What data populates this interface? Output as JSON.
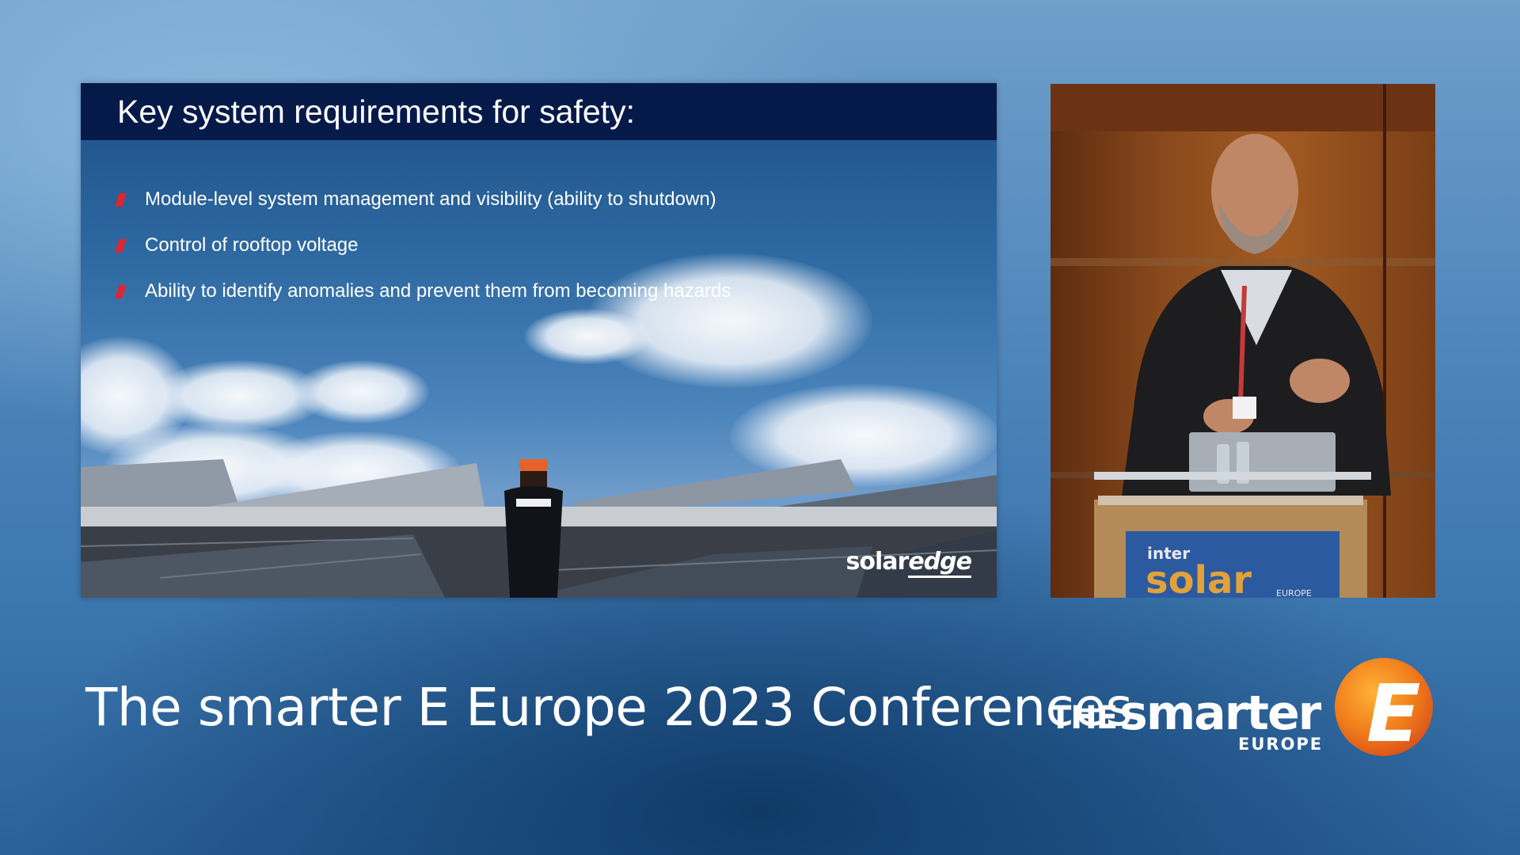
{
  "slide": {
    "title": "Key system requirements for safety:",
    "bullets": [
      "Module-level system management and visibility (ability to shutdown)",
      "Control of rooftop voltage",
      "Ability to identify anomalies and prevent them from becoming hazards"
    ],
    "logo_word1": "solar",
    "logo_word2": "edge",
    "shirt_text": "solaredge"
  },
  "speaker": {
    "podium_small": "inter",
    "podium_big": "solar",
    "podium_sub": "EUROPE"
  },
  "footer": {
    "title": "The smarter E Europe 2023 Conferences"
  },
  "brand": {
    "the": "THE",
    "smarter": "smarter",
    "europe": "EUROPE",
    "letter": "E"
  },
  "colors": {
    "slide_header": "#061a4a",
    "bullet_accent": "#e0252f",
    "brand_orange": "#f07d1a",
    "podium_gold": "#e2a23a"
  }
}
